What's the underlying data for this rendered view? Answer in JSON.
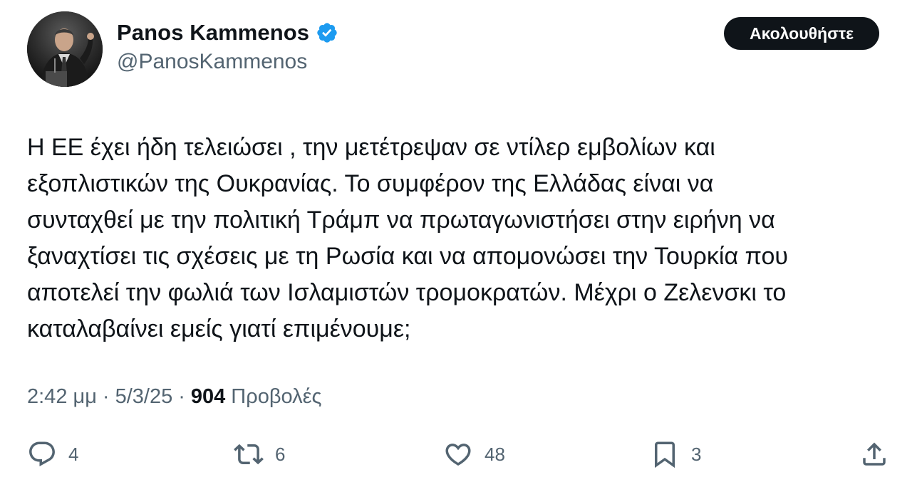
{
  "author": {
    "display_name": "Panos Kammenos",
    "handle": "@PanosKammenos",
    "verified": true,
    "verified_color": "#1d9bf0"
  },
  "follow_button": {
    "label": "Ακολουθήστε"
  },
  "tweet": {
    "text_lines": [
      "Η ΕΕ έχει ήδη τελειώσει , την μετέτρεψαν σε ντίλερ εμβολίων και",
      "εξοπλιστικών της Ουκρανίας. Το συμφέρον της Ελλάδας είναι να",
      "συνταχθεί με την πολιτική Τράμπ να πρωταγωνιστήσει στην ειρήνη να",
      "ξαναχτίσει τις σχέσεις με τη Ρωσία και να απομονώσει την Τουρκία που",
      "αποτελεί την φωλιά των Ισλαμιστών τρομοκρατών. Μέχρι ο Ζελενσκι το",
      "καταλαβαίνει εμείς γιατί επιμένουμε;"
    ]
  },
  "meta": {
    "time": "2:42 μμ",
    "separator": "·",
    "date": "5/3/25",
    "views_count": "904",
    "views_label": "Προβολές"
  },
  "actions": {
    "reply": {
      "icon": "reply-icon",
      "count": "4"
    },
    "retweet": {
      "icon": "retweet-icon",
      "count": "6"
    },
    "like": {
      "icon": "heart-icon",
      "count": "48"
    },
    "bookmark": {
      "icon": "bookmark-icon",
      "count": "3"
    },
    "share": {
      "icon": "share-icon"
    }
  },
  "colors": {
    "text_primary": "#0f1419",
    "text_secondary": "#536471",
    "button_bg": "#0f1419",
    "button_text": "#ffffff"
  }
}
